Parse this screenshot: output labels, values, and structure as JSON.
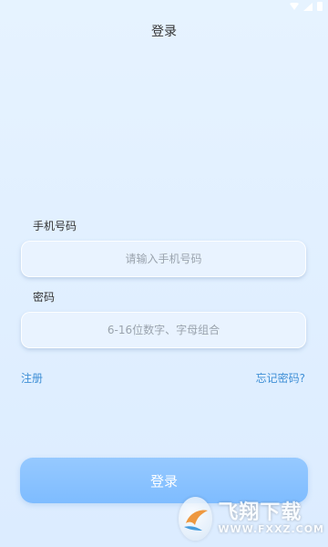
{
  "header": {
    "title": "登录"
  },
  "form": {
    "phone_label": "手机号码",
    "phone_placeholder": "请输入手机号码",
    "phone_value": "",
    "password_label": "密码",
    "password_placeholder": "6-16位数字、字母组合",
    "password_value": ""
  },
  "links": {
    "register": "注册",
    "forgot_password": "忘记密码?"
  },
  "actions": {
    "login_button": "登录"
  },
  "watermark": {
    "name_cn": "飞翔下载",
    "url": "WWW.FXXZ.COM"
  },
  "colors": {
    "accent": "#3f8fd6",
    "button": "#7ebcff",
    "background": "#e6f3ff"
  },
  "icons": {
    "status": [
      "wifi-icon",
      "signal-icon",
      "battery-icon"
    ],
    "watermark": "fxxz-logo-icon"
  }
}
